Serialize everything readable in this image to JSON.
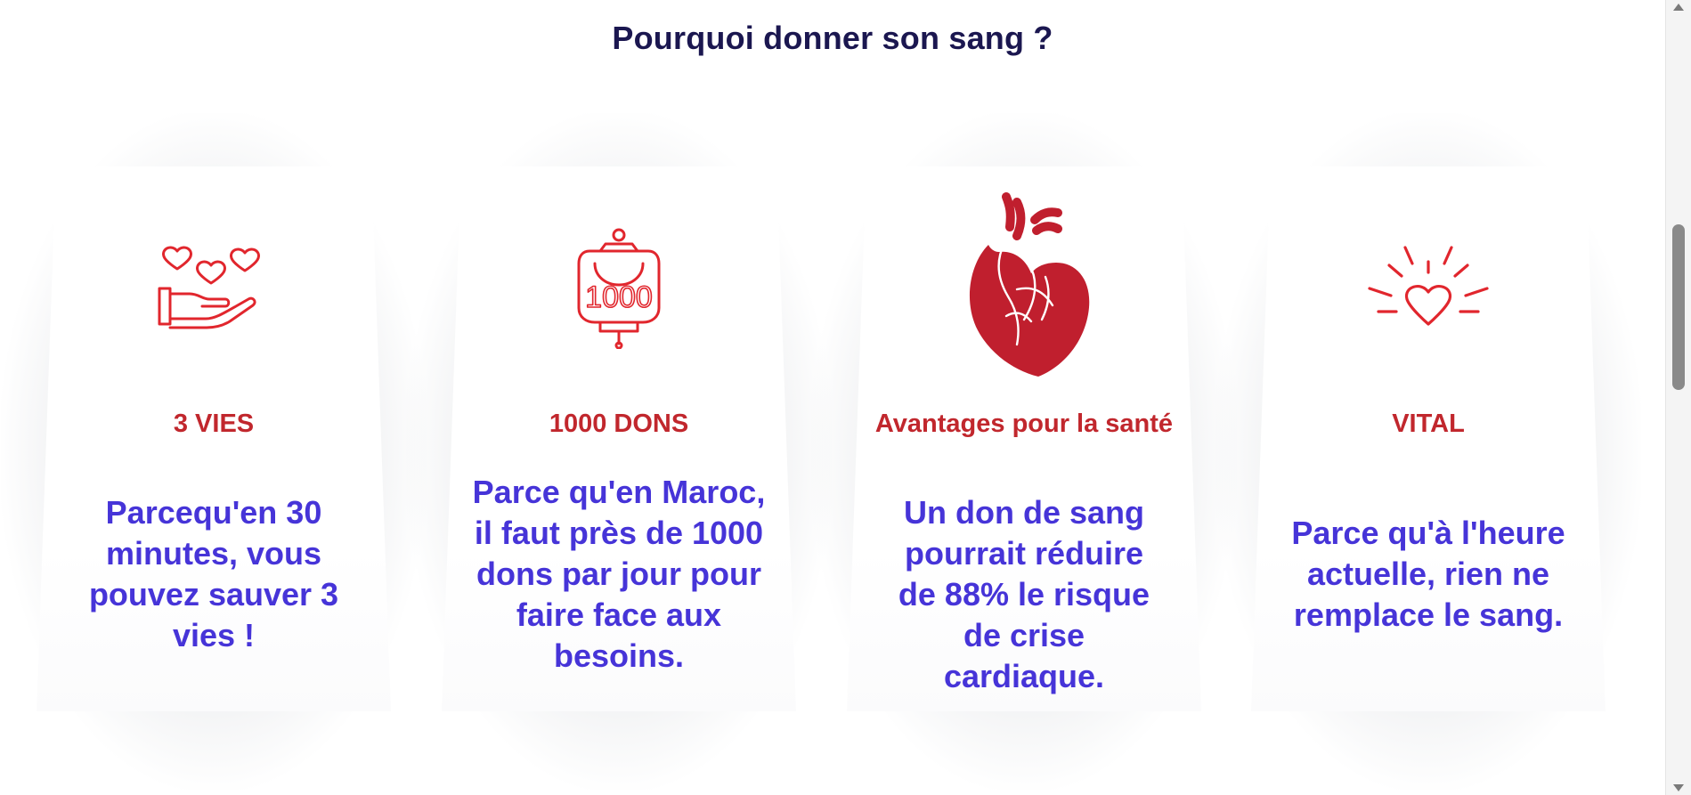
{
  "section": {
    "title": "Pourquoi donner son sang ?"
  },
  "cards": [
    {
      "icon": "hand-hearts-icon",
      "heading": "3 VIES",
      "text": "Parcequ'en 30 minutes, vous pouvez sauver 3 vies !"
    },
    {
      "icon": "blood-bag-1000-icon",
      "icon_label": "1000",
      "heading": "1000 DONS",
      "text": "Parce qu'en Maroc, il faut près de 1000 dons par jour pour faire face aux besoins."
    },
    {
      "icon": "anatomical-heart-icon",
      "heading": "Avantages pour la santé",
      "text": "Un don de sang pourrait réduire de 88% le risque de crise cardiaque."
    },
    {
      "icon": "radiant-heart-icon",
      "heading": "VITAL",
      "text": "Parce qu'à l'heure actuelle, rien ne remplace le sang."
    }
  ],
  "colors": {
    "title": "#1b1750",
    "heading": "#c1272d",
    "body_text": "#4634d8",
    "icon": "#e1262d"
  },
  "scrollbar": {
    "icon_up": "arrow-up-icon",
    "icon_down": "arrow-down-icon"
  }
}
